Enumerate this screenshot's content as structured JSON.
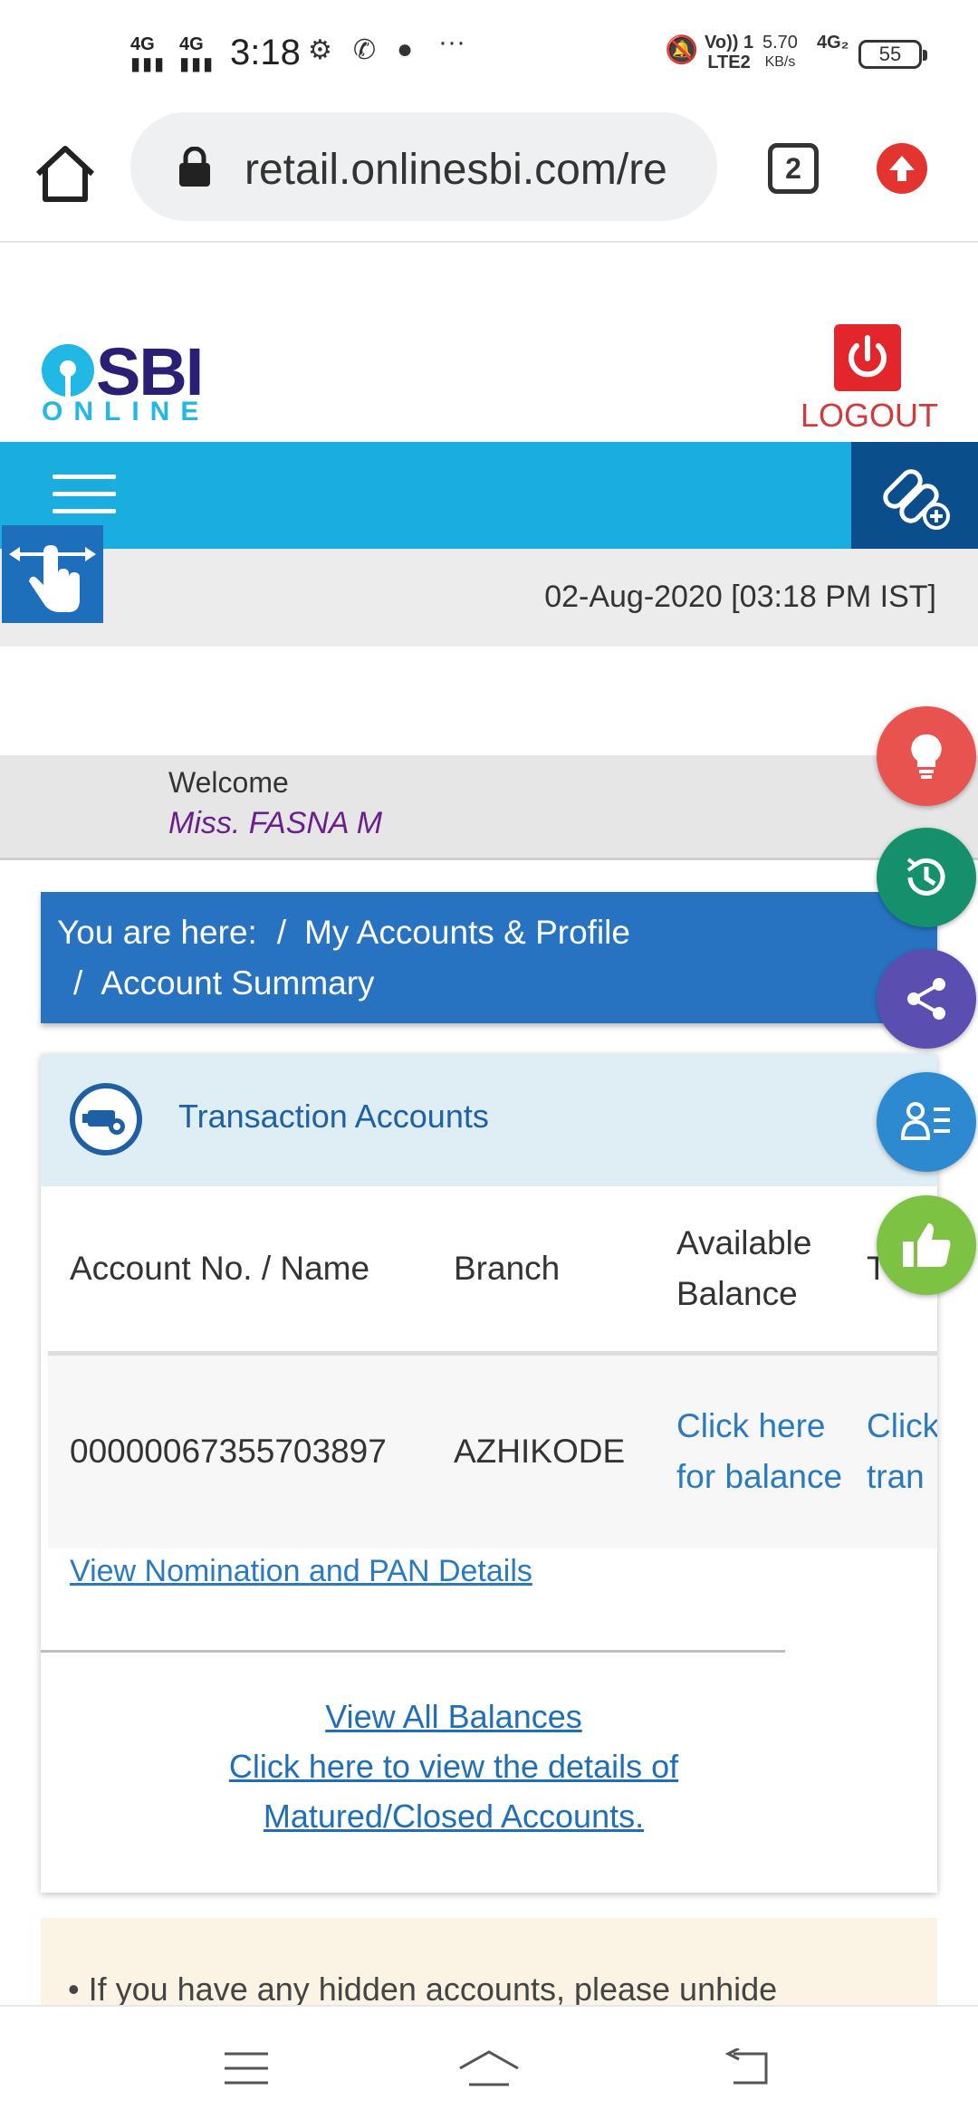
{
  "status_bar": {
    "time": "3:18",
    "signal1": "4G",
    "signal2": "4G",
    "net_volte": "Vo)) 1",
    "net_lte": "LTE2",
    "speed_value": "5.70",
    "speed_unit": "KB/s",
    "net_4g": "4G₂",
    "battery": "55"
  },
  "browser": {
    "url": "retail.onlinesbi.com/re",
    "tab_count": "2"
  },
  "header": {
    "logo_main": "SBI",
    "logo_sub": "ONLINE",
    "logout_label": "LOGOUT"
  },
  "date_time": "02-Aug-2020 [03:18 PM IST]",
  "welcome": {
    "greeting": "Welcome",
    "name": "Miss. FASNA M"
  },
  "breadcrumb": {
    "prefix": "You are here:",
    "items": [
      "My Accounts & Profile",
      "Account Summary"
    ]
  },
  "transaction_accounts": {
    "title": "Transaction Accounts",
    "columns": [
      "Account No. / Name",
      "Branch",
      "Available Balance",
      "T"
    ],
    "rows": [
      {
        "account": "00000067355703897",
        "branch": "AZHIKODE",
        "balance_link": "Click here for balance",
        "transactions_link": "Click for tran"
      }
    ],
    "nomination_link": "View Nomination and PAN Details",
    "view_all_balances": "View All Balances",
    "matured_closed_link": "Click here to view the details of Matured/Closed Accounts."
  },
  "notice": {
    "text": "If you have any hidden accounts, please unhide"
  },
  "colors": {
    "nav_blue": "#1aaddf",
    "dark_blue": "#0b4e8c",
    "breadcrumb_blue": "#2773c2",
    "link_blue": "#2a7ac1",
    "logout_red": "#e3262b",
    "welcome_name": "#6b1f8f"
  },
  "icons": [
    "home-icon",
    "lock-icon",
    "tabs-icon",
    "update-icon",
    "power-icon",
    "hamburger-icon",
    "quick-link-icon",
    "gesture-icon",
    "bulb-icon",
    "history-icon",
    "share-icon",
    "contact-list-icon",
    "thumbs-up-icon",
    "menu-icon",
    "home-nav-icon",
    "back-icon"
  ]
}
